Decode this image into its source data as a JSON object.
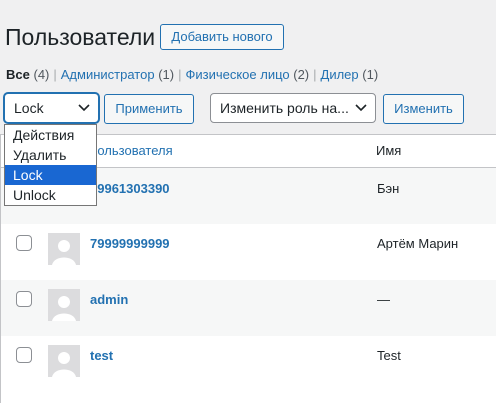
{
  "page": {
    "title": "Пользователи",
    "add_new_label": "Добавить нового"
  },
  "filters": [
    {
      "label": "Все",
      "count": "(4)"
    },
    {
      "label": "Администратор",
      "count": "(1)"
    },
    {
      "label": "Физическое лицо",
      "count": "(2)"
    },
    {
      "label": "Дилер",
      "count": "(1)"
    }
  ],
  "bulk_action": {
    "selected": "Lock",
    "apply_label": "Применить",
    "options": [
      "Действия",
      "Удалить",
      "Lock",
      "Unlock"
    ],
    "highlighted_option": "Lock"
  },
  "change_role": {
    "placeholder": "Изменить роль на...",
    "button_label": "Изменить"
  },
  "table": {
    "columns": {
      "login": "Пользователя",
      "name": "Имя"
    },
    "rows": [
      {
        "login": "79961303390",
        "name": "Бэн"
      },
      {
        "login": "79999999999",
        "name": "Артём Марин"
      },
      {
        "login": "admin",
        "name": "—"
      },
      {
        "login": "test",
        "name": "Test"
      }
    ]
  },
  "colors": {
    "accent": "#2271b1",
    "highlight": "#1967d2",
    "background": "#f0f0f1"
  },
  "icons": {
    "select_arrow": "chevron-down-icon",
    "avatar": "default-avatar-icon"
  }
}
